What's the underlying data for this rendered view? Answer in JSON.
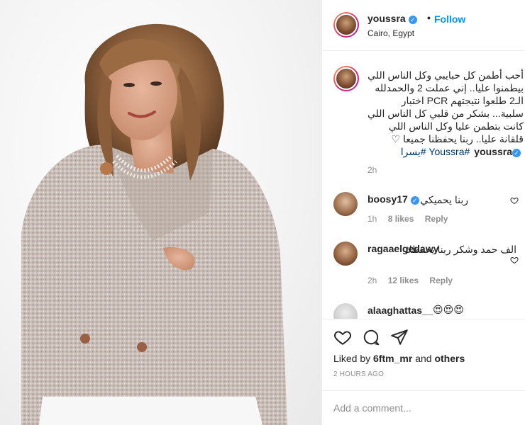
{
  "post": {
    "username": "youssra",
    "location": "Cairo, Egypt",
    "dot": "•",
    "follow_label": "Follow",
    "verified_glyph": "✓"
  },
  "caption": {
    "username": "youssra",
    "text": "أحب أطمن كل حبايبي وكل الناس اللي بيطمنوا عليا.. إني عملت 2 والحمدلله الـ2 طلعوا نتيجتهم PCR اختبار سلبية... بشكر من قلبي كل الناس اللي كانت بتطمن عليا وكل الناس اللي قلقانة عليا.. ربنا يحفظنا جميعا ♡",
    "tags": "#Youssra #يسرا",
    "time": "2h"
  },
  "comments": [
    {
      "username": "boosy17",
      "verified": true,
      "text": "ربنا يحميكي",
      "time": "1h",
      "likes": "8 likes",
      "reply": "Reply"
    },
    {
      "username": "ragaaelgedawy",
      "verified": false,
      "text": "الف حمد وشكر ربنا يحفظك",
      "time": "2h",
      "likes": "12 likes",
      "reply": "Reply"
    },
    {
      "username": "alaaghattas__",
      "verified": false,
      "text": "😍😍😍"
    }
  ],
  "actions": {
    "icons": [
      "heart-icon",
      "comment-icon",
      "share-icon"
    ],
    "liked_prefix": "Liked by",
    "liked_user": "6ftm_mr",
    "liked_and": "and",
    "liked_others": "others",
    "time_ago": "2 HOURS AGO",
    "comment_placeholder": "Add a comment..."
  },
  "colors": {
    "accent": "#0095f6",
    "verified": "#3897f0",
    "muted": "#8e8e8e",
    "hashtag": "#00376b"
  }
}
